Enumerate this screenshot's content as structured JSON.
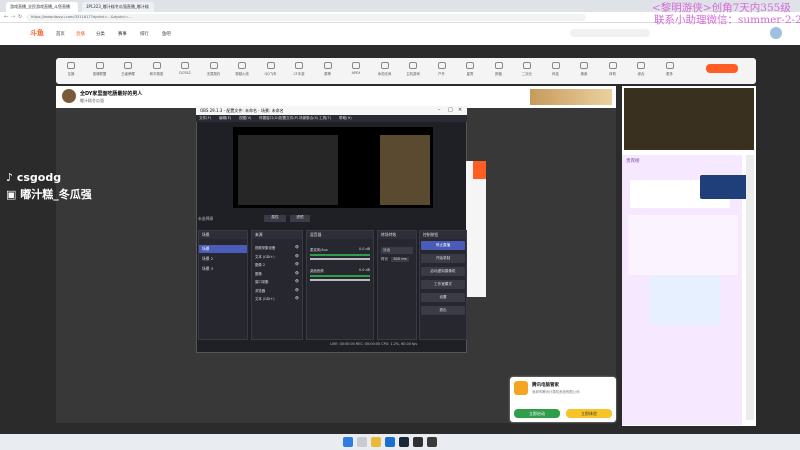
{
  "browser": {
    "tabs": [
      {
        "label": "游戏直播_全民游戏直播_斗鱼直播"
      },
      {
        "label": "3PL323_嘟汁糕冬瓜强直播_嘟汁糕"
      }
    ],
    "url": "https://www.douyu.com/3311617?dyshid=...&dyshci=..."
  },
  "site": {
    "logo": "斗鱼",
    "nav": [
      "首页",
      "直播",
      "分类",
      "赛事",
      "排行",
      "鱼吧"
    ],
    "search_placeholder": "",
    "categories": [
      "互娱",
      "英雄联盟",
      "王者荣耀",
      "和平精英",
      "DOTA2",
      "无畏契约",
      "穿越火线",
      "QQ飞车",
      "CF手游",
      "原神",
      "APEX",
      "永劫无间",
      "主机游戏",
      "户外",
      "星秀",
      "颜值",
      "二次元",
      "科技",
      "美食",
      "体育",
      "综合",
      "更多"
    ]
  },
  "room": {
    "title": "全DY家里面吃肠最好的男人",
    "streamer": "嘟汁糕冬瓜强",
    "chat_header": "贵宾榜"
  },
  "obs": {
    "title": "OBS 29.1.3 - 配置文件: 未命名 - 场景: 未命名",
    "menu": [
      "文件(F)",
      "编辑(E)",
      "视图(V)",
      "停靠窗口(D)",
      "配置文件(P)",
      "场景集合(S)",
      "工具(T)",
      "帮助(H)"
    ],
    "no_source": "未选择源",
    "props_btn": "属性",
    "filters_btn": "滤镜",
    "scenes_header": "场景",
    "scenes": [
      "场景",
      "场景 2",
      "场景 3"
    ],
    "sources_header": "来源",
    "sources": [
      "视频采集设备",
      "文本 (GDI+)",
      "图像 2",
      "图像",
      "窗口采集",
      "浏览器",
      "文本 (GDI+)"
    ],
    "mixer_header": "混音器",
    "mixer": [
      {
        "name": "桌面音频",
        "value": "0.0 dB"
      },
      {
        "name": "麦克风/Aux",
        "value": "0.0 dB"
      }
    ],
    "transitions_header": "转场特效",
    "transition_value": "淡出",
    "duration_label": "时长",
    "duration_value": "300 ms",
    "controls_header": "控制按钮",
    "controls": [
      "停止直播",
      "开始录制",
      "启动虚拟摄像机",
      "工作室模式",
      "设置",
      "退出"
    ],
    "status": "LIVE: 00:00:00   REC: 00:00:00   CPU: 1.2%, 60.00 fps"
  },
  "overlay": {
    "tiktok_handle": "csgodg",
    "stream_name": "嘟汁糕_冬瓜强",
    "line1": "<黎明游侠>创角7天内355级",
    "line2": "联系小助理微信：summer-2-21"
  },
  "popup": {
    "title": "腾讯电脑管家",
    "subtitle": "深圳市腾讯计算机系统有限公司",
    "btn_left": "立即启动",
    "btn_right": "立即体验"
  },
  "colors": {
    "accent": "#ff5d23",
    "obs_bg": "#1f1f26",
    "overlay": "#d56bd8"
  }
}
